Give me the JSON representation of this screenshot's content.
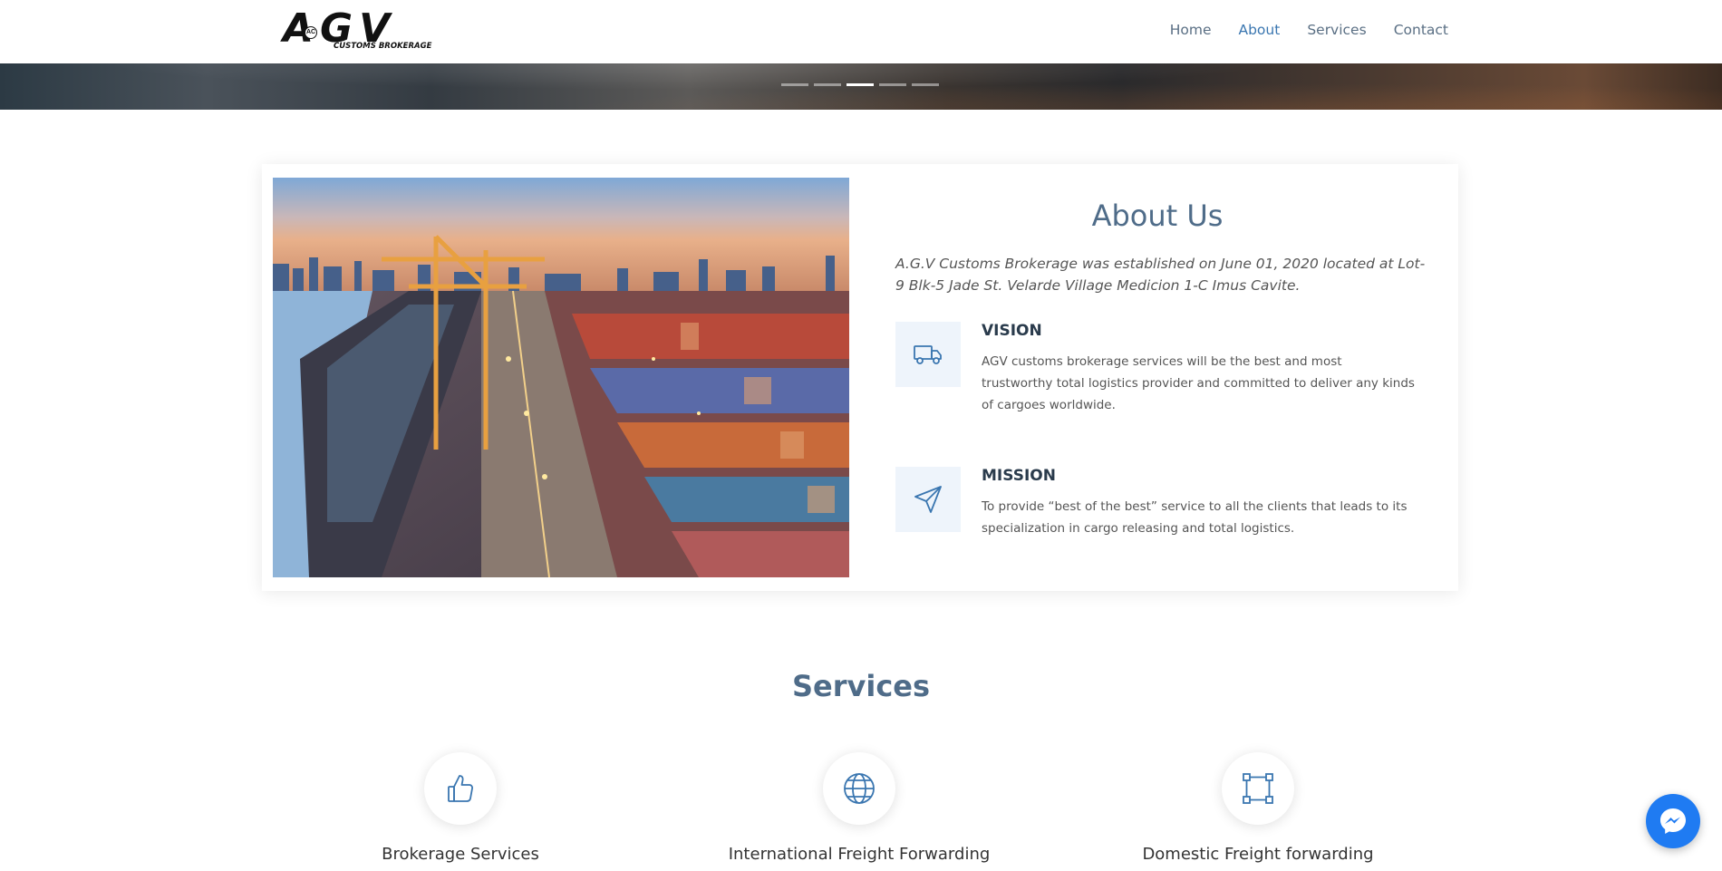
{
  "header": {
    "logo_text": "AGV",
    "logo_subtext": "CUSTOMS BROKERAGE",
    "logo_monogram": "AC",
    "nav": [
      {
        "label": "Home",
        "active": false
      },
      {
        "label": "About",
        "active": true
      },
      {
        "label": "Services",
        "active": false
      },
      {
        "label": "Contact",
        "active": false
      }
    ]
  },
  "hero": {
    "slide_count": 5,
    "active_slide": 3
  },
  "about": {
    "title": "About Us",
    "description": "A.G.V Customs Brokerage was established on June 01, 2020 located at Lot-9 Blk-5 Jade St. Velarde Village Medicion 1-C Imus Cavite.",
    "image": "port-container-terminal",
    "vision": {
      "icon": "truck-icon",
      "title": "VISION",
      "text": "AGV customs brokerage services will be the best and most trustworthy total logistics provider and committed to deliver any kinds of cargoes worldwide."
    },
    "mission": {
      "icon": "paper-plane-icon",
      "title": "MISSION",
      "text": "To provide “best of the best” service to all the clients that leads to its specialization in cargo releasing and total logistics."
    }
  },
  "services": {
    "title": "Services",
    "items": [
      {
        "icon": "thumbs-up-icon",
        "label": "Brokerage Services"
      },
      {
        "icon": "globe-icon",
        "label": "International Freight Forwarding"
      },
      {
        "icon": "crop-frame-icon",
        "label": "Domestic Freight forwarding"
      }
    ]
  },
  "colors": {
    "accent": "#3a76b0",
    "heading": "#4f6c89",
    "icon_bg": "#eef4fb",
    "messenger": "#1f7bf2"
  }
}
